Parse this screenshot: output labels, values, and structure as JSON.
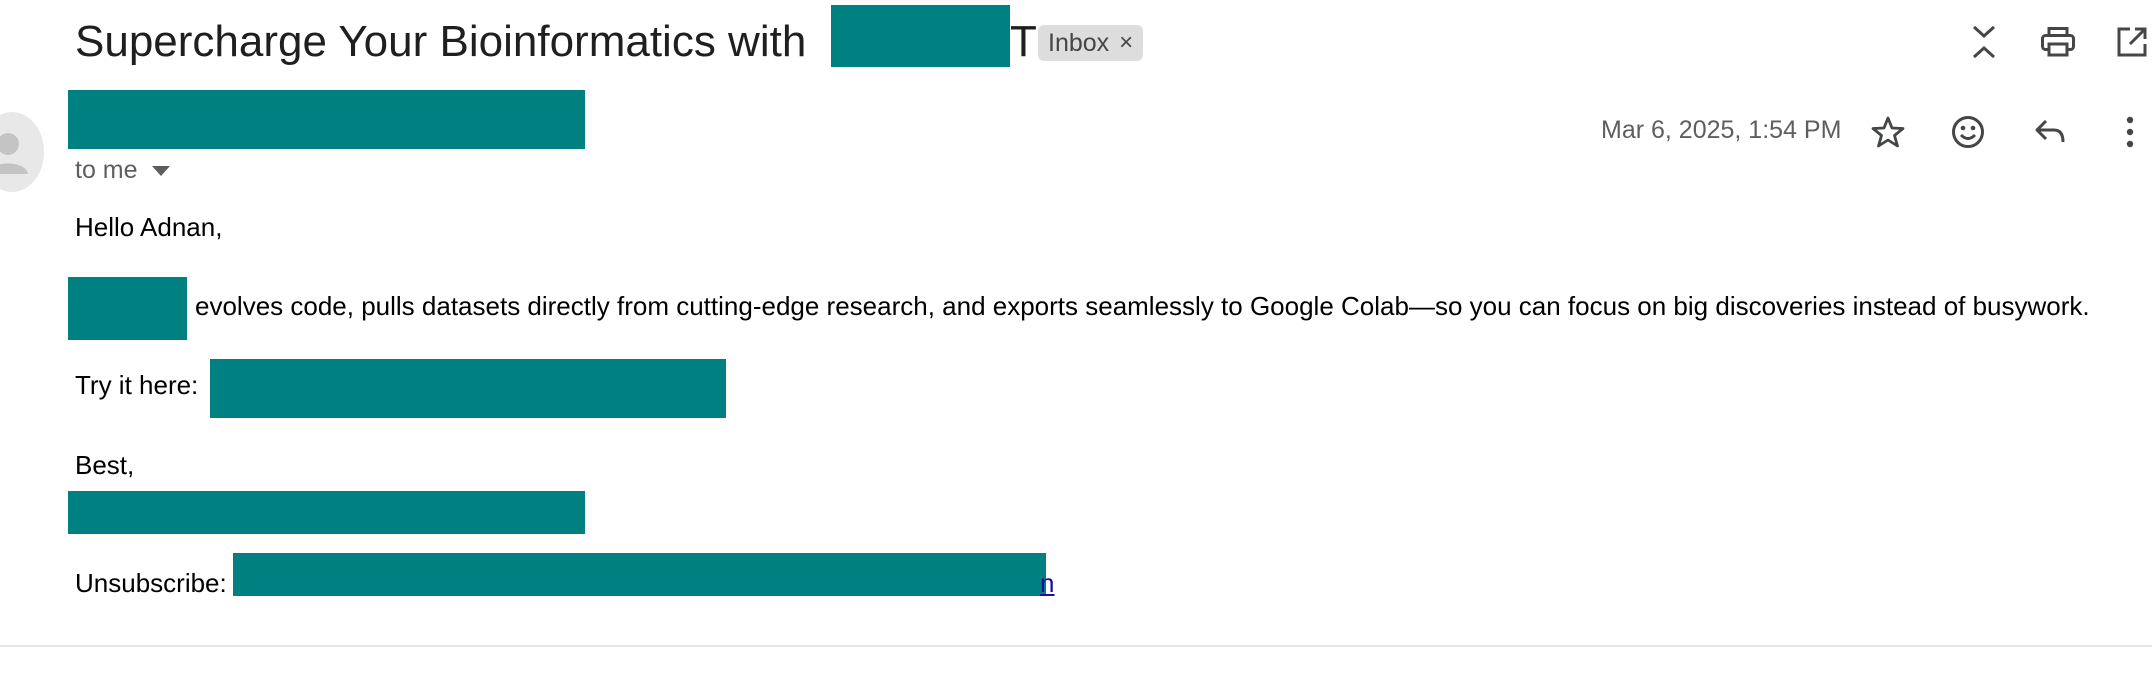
{
  "email": {
    "subject": "Supercharge Your Bioinformatics with",
    "subject_tail": "T",
    "label_chip": "Inbox",
    "label_remove": "×",
    "recipient": "to me",
    "date": "Mar 6, 2025, 1:54 PM"
  },
  "body": {
    "greeting": "Hello Adnan,",
    "paragraph": "evolves code, pulls datasets directly from cutting-edge research, and exports seamlessly to Google Colab—so you can focus on big discoveries instead of busywork.",
    "try_label": "Try it here:",
    "signoff": "Best,",
    "unsubscribe_label": "Unsubscribe:",
    "unsubscribe_link_tail": "n"
  },
  "icons": {
    "collapse": "collapse-all-icon",
    "print": "print-icon",
    "open_new_window": "open-in-new-window-icon",
    "star": "star-icon",
    "emoji": "emoji-reaction-icon",
    "reply": "reply-icon",
    "more": "more-options-icon",
    "avatar": "avatar-icon"
  },
  "colors": {
    "redaction": "#008080",
    "link": "#1a0dab",
    "chip_bg": "#dddddd"
  }
}
